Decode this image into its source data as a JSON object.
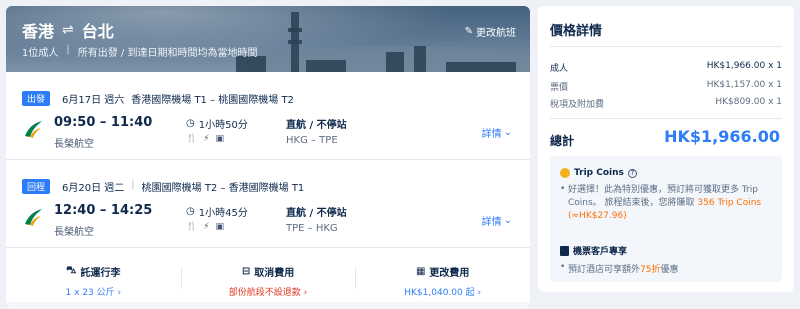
{
  "header": {
    "origin": "香港",
    "destination": "台北",
    "passengers": "1位成人",
    "note": "所有出發 / 到達日期和時間均為當地時間",
    "change_label": "更改航班"
  },
  "segments": [
    {
      "tag": "出發",
      "date": "6月17日 週六",
      "route": "香港國際機場 T1 – 桃園國際機場 T2",
      "times": "09:50 – 11:40",
      "airline": "長榮航空",
      "duration": "1小時50分",
      "direct": "直航 / 不停站",
      "codes": "HKG – TPE",
      "details": "詳情"
    },
    {
      "tag": "回程",
      "date": "6月20日 週二",
      "route": "桃園國際機場 T2 – 香港國際機場 T1",
      "times": "12:40 – 14:25",
      "airline": "長榮航空",
      "duration": "1小時45分",
      "direct": "直航 / 不停站",
      "codes": "TPE – HKG",
      "details": "詳情"
    }
  ],
  "bottom": {
    "baggage_title": "託運行李",
    "baggage_value": "1 x 23 公斤",
    "cancel_title": "取消費用",
    "cancel_value": "部份航段不設退款",
    "change_title": "更改費用",
    "change_value": "HK$1,040.00 起"
  },
  "price": {
    "title": "價格詳情",
    "adult_label": "成人",
    "adult_value": "HK$1,966.00 x 1",
    "fare_label": "票價",
    "fare_value": "HK$1,157.00 x 1",
    "tax_label": "稅項及附加費",
    "tax_value": "HK$809.00 x 1",
    "total_label": "總計",
    "total_value": "HK$1,966.00"
  },
  "coins": {
    "title": "Trip Coins",
    "text_a": "好選擇！此為特別優惠，預訂將可獲取更多 Trip Coins。 旅程結束後，您將賺取 ",
    "amount": "356 Trip Coins (≈HK$27.96)",
    "vip_title": "機票客戶專享",
    "vip_text_a": "預訂酒店可享額外",
    "vip_discount": "75折",
    "vip_text_b": "優惠"
  },
  "colors": {
    "accent": "#2d7df6",
    "tag": "#2d7df6",
    "warning": "#e0341f",
    "coin": "#ff6f00"
  }
}
